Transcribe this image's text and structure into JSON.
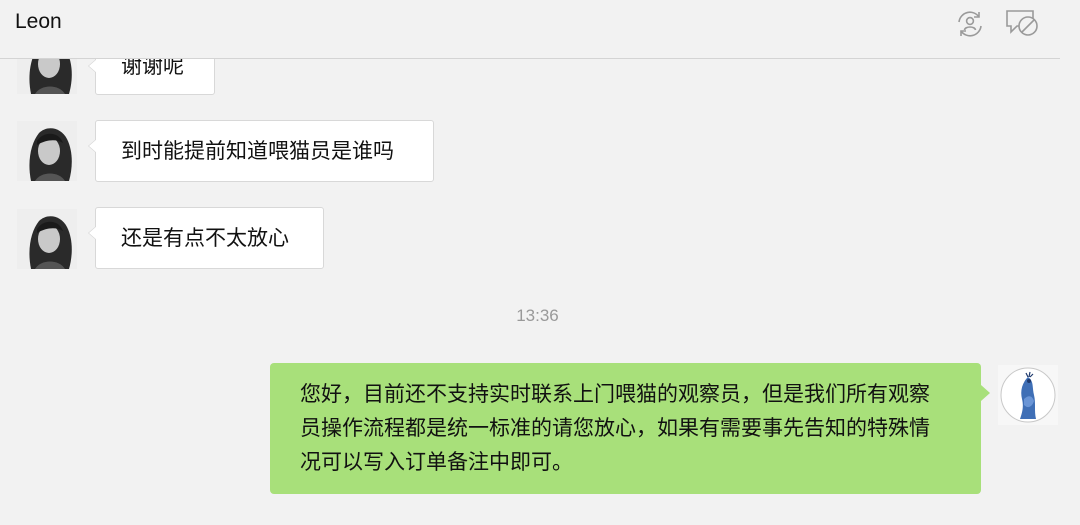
{
  "header": {
    "title": "Leon",
    "icons": [
      "contact-sync-icon",
      "chat-disabled-icon"
    ]
  },
  "messages": [
    {
      "side": "left",
      "text": "谢谢呢",
      "avatar": "user-avatar"
    },
    {
      "side": "left",
      "text": "到时能提前知道喂猫员是谁吗",
      "avatar": "user-avatar"
    },
    {
      "side": "left",
      "text": "还是有点不太放心",
      "avatar": "user-avatar"
    }
  ],
  "timestamp": "13:36",
  "reply": {
    "side": "right",
    "lines": [
      "您好，目前还不支持实时联系上门喂猫的观察员，但是我们所有观察",
      "员操作流程都是统一标准的请您放心，如果有需要事先告知的特殊情",
      "况可以写入订单备注中即可。"
    ],
    "avatar": "peacock-avatar"
  },
  "colors": {
    "background": "#f2f2f2",
    "incoming_bubble": "#ffffff",
    "outgoing_bubble": "#a8e07a",
    "timestamp": "#999999"
  }
}
